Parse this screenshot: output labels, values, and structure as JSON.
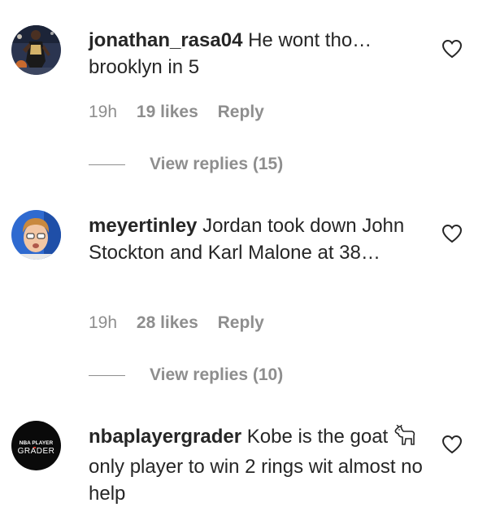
{
  "comments": [
    {
      "username": "jonathan_rasa04",
      "text": "He wont tho… brooklyn in 5",
      "time": "19h",
      "likes": "19 likes",
      "reply": "Reply",
      "view_replies": "View replies (15)",
      "avatar_icon": "avatar-basketball-player"
    },
    {
      "username": "meyertinley",
      "text": "Jordan took down John Stockton and Karl Malone at 38…",
      "time": "19h",
      "likes": "28 likes",
      "reply": "Reply",
      "view_replies": "View replies (10)",
      "avatar_icon": "avatar-face"
    },
    {
      "username": "nbaplayergrader",
      "text_before_emoji": "Kobe is the goat",
      "emoji": "goat-icon",
      "text_after_emoji": "only player to win 2 rings wit almost no help",
      "avatar_line1": "NBA PLAYER",
      "avatar_line2": "GRADER",
      "avatar_icon": "avatar-logo"
    }
  ],
  "colors": {
    "text": "#262626",
    "secondary": "#8e8e8e",
    "background": "#ffffff"
  }
}
